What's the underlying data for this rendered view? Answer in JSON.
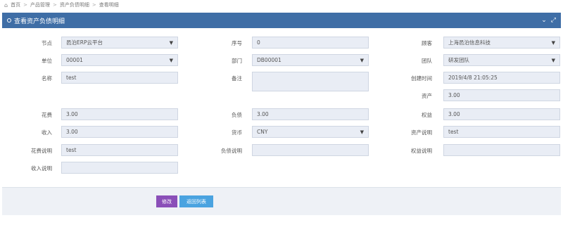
{
  "breadcrumb": [
    "首页",
    "产品管理",
    "资产负债明细",
    "查看明细"
  ],
  "panel": {
    "title": "查看资产负债明细"
  },
  "form": {
    "node": {
      "label": "节点",
      "value": "邑泊ERP云平台"
    },
    "seq": {
      "label": "序号",
      "value": "0"
    },
    "customer": {
      "label": "顾客",
      "value": "上海邑泊信息科技"
    },
    "unit": {
      "label": "单位",
      "value": "00001"
    },
    "dept": {
      "label": "部门",
      "value": "DB00001"
    },
    "team": {
      "label": "团队",
      "value": "研发团队"
    },
    "name": {
      "label": "名称",
      "value": "test"
    },
    "remark": {
      "label": "备注",
      "value": ""
    },
    "created": {
      "label": "创建时间",
      "value": "2019/4/8 21:05:25"
    },
    "asset": {
      "label": "资产",
      "value": "3.00"
    },
    "expense": {
      "label": "花费",
      "value": "3.00"
    },
    "liability": {
      "label": "负债",
      "value": "3.00"
    },
    "equity": {
      "label": "权益",
      "value": "3.00"
    },
    "income": {
      "label": "收入",
      "value": "3.00"
    },
    "currency": {
      "label": "货币",
      "value": "CNY"
    },
    "asset_desc": {
      "label": "资产说明",
      "value": "test"
    },
    "expense_desc": {
      "label": "花费说明",
      "value": "test"
    },
    "liability_desc": {
      "label": "负债说明",
      "value": ""
    },
    "equity_desc": {
      "label": "权益说明",
      "value": ""
    },
    "income_desc": {
      "label": "收入说明",
      "value": ""
    }
  },
  "buttons": {
    "edit": "修改",
    "back": "返回列表"
  }
}
